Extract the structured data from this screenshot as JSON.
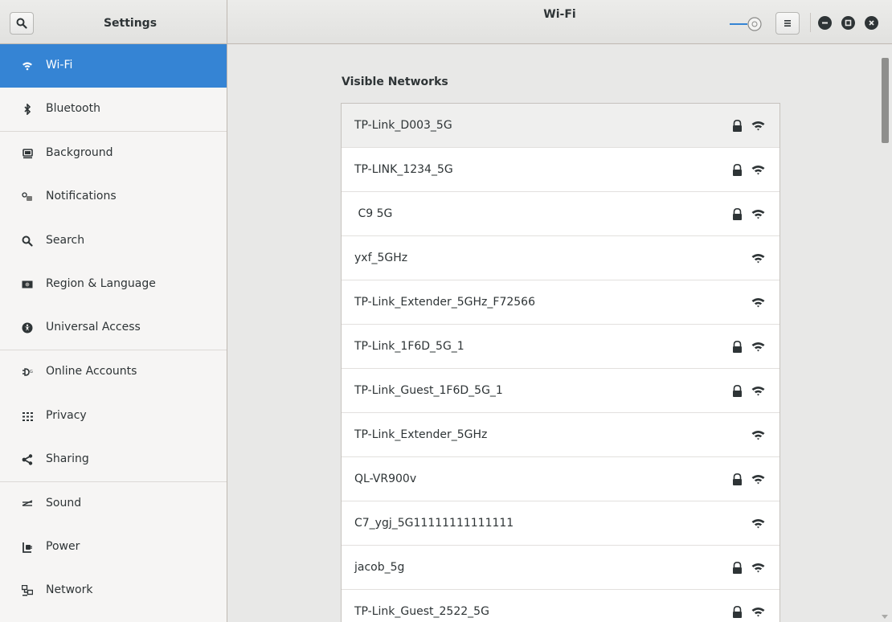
{
  "header": {
    "left_title": "Settings",
    "title": "Wi-Fi",
    "wifi_switch_on": true
  },
  "sidebar": {
    "items": [
      {
        "label": "Wi-Fi",
        "icon": "wifi-icon"
      },
      {
        "label": "Bluetooth",
        "icon": "bluetooth-icon"
      },
      {
        "label": "Background",
        "icon": "background-icon"
      },
      {
        "label": "Notifications",
        "icon": "notifications-icon"
      },
      {
        "label": "Search",
        "icon": "search-icon"
      },
      {
        "label": "Region & Language",
        "icon": "region-icon"
      },
      {
        "label": "Universal Access",
        "icon": "universal-access-icon"
      },
      {
        "label": "Online Accounts",
        "icon": "online-accounts-icon"
      },
      {
        "label": "Privacy",
        "icon": "privacy-icon"
      },
      {
        "label": "Sharing",
        "icon": "sharing-icon"
      },
      {
        "label": "Sound",
        "icon": "sound-icon"
      },
      {
        "label": "Power",
        "icon": "power-icon"
      },
      {
        "label": "Network",
        "icon": "network-icon"
      }
    ]
  },
  "main": {
    "section_title": "Visible Networks",
    "networks": [
      {
        "name": "TP-Link_D003_5G",
        "secured": true
      },
      {
        "name": "TP-LINK_1234_5G",
        "secured": true
      },
      {
        "name": " C9 5G",
        "secured": true
      },
      {
        "name": "yxf_5GHz",
        "secured": false
      },
      {
        "name": "TP-Link_Extender_5GHz_F72566",
        "secured": false
      },
      {
        "name": "TP-Link_1F6D_5G_1",
        "secured": true
      },
      {
        "name": "TP-Link_Guest_1F6D_5G_1",
        "secured": true
      },
      {
        "name": "TP-Link_Extender_5GHz",
        "secured": false
      },
      {
        "name": "QL-VR900v",
        "secured": true
      },
      {
        "name": "C7_ygj_5G11111111111111",
        "secured": false
      },
      {
        "name": "jacob_5g",
        "secured": true
      },
      {
        "name": "TP-Link_Guest_2522_5G",
        "secured": true
      }
    ]
  },
  "colors": {
    "accent": "#3584d4",
    "text": "#2e3436",
    "sidebar_bg": "#f6f5f4",
    "content_bg": "#e8e8e7"
  }
}
